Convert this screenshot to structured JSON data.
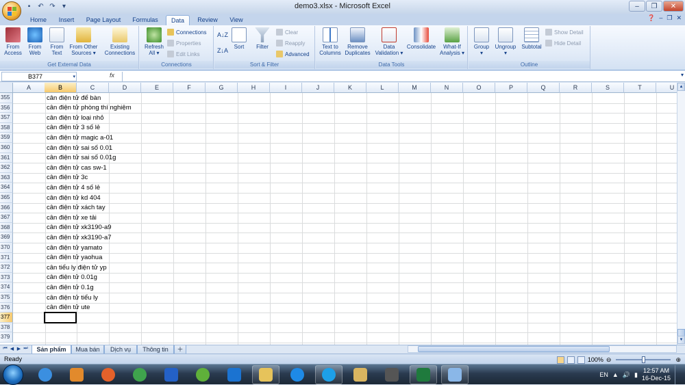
{
  "window": {
    "title": "demo3.xlsx - Microsoft Excel"
  },
  "tabs": [
    "Home",
    "Insert",
    "Page Layout",
    "Formulas",
    "Data",
    "Review",
    "View"
  ],
  "active_tab": "Data",
  "ribbon": {
    "get_external": {
      "label": "Get External Data",
      "from_access": "From\nAccess",
      "from_web": "From\nWeb",
      "from_text": "From\nText",
      "from_other": "From Other\nSources ▾",
      "existing": "Existing\nConnections"
    },
    "connections": {
      "label": "Connections",
      "refresh": "Refresh\nAll ▾",
      "connections": "Connections",
      "properties": "Properties",
      "edit_links": "Edit Links"
    },
    "sort_filter": {
      "label": "Sort & Filter",
      "sort": "Sort",
      "filter": "Filter",
      "clear": "Clear",
      "reapply": "Reapply",
      "advanced": "Advanced"
    },
    "data_tools": {
      "label": "Data Tools",
      "text_to_columns": "Text to\nColumns",
      "remove_duplicates": "Remove\nDuplicates",
      "data_validation": "Data\nValidation ▾",
      "consolidate": "Consolidate",
      "what_if": "What-If\nAnalysis ▾"
    },
    "outline": {
      "label": "Outline",
      "group": "Group\n▾",
      "ungroup": "Ungroup\n▾",
      "subtotal": "Subtotal",
      "show_detail": "Show Detail",
      "hide_detail": "Hide Detail"
    }
  },
  "formula_bar": {
    "name_box": "B377",
    "fx": "fx",
    "value": ""
  },
  "columns": [
    "A",
    "B",
    "C",
    "D",
    "E",
    "F",
    "G",
    "H",
    "I",
    "J",
    "K",
    "L",
    "M",
    "N",
    "O",
    "P",
    "Q",
    "R",
    "S",
    "T",
    "U"
  ],
  "rows": [
    {
      "n": "355",
      "b": "cân điện tử để bàn"
    },
    {
      "n": "356",
      "b": "cân điện tử phòng thí nghiệm"
    },
    {
      "n": "357",
      "b": "cân điện tử loại nhỏ"
    },
    {
      "n": "358",
      "b": "cân điện tử 3 số lẻ"
    },
    {
      "n": "359",
      "b": "cân điện tử magic a-01"
    },
    {
      "n": "360",
      "b": "cân điện tử sai số 0.01"
    },
    {
      "n": "361",
      "b": "cân điện tử sai số 0.01g"
    },
    {
      "n": "362",
      "b": "cân điện tử cas sw-1"
    },
    {
      "n": "363",
      "b": "cân điện tử 3c"
    },
    {
      "n": "364",
      "b": "cân điện tử 4 số lẻ"
    },
    {
      "n": "365",
      "b": "cân điện tử kd 404"
    },
    {
      "n": "366",
      "b": "cân điện tử xách tay"
    },
    {
      "n": "367",
      "b": "cân điện tử xe tải"
    },
    {
      "n": "368",
      "b": "cân điện tử xk3190-a9"
    },
    {
      "n": "369",
      "b": "cân điện tử xk3190-a7"
    },
    {
      "n": "370",
      "b": "cân điện tử yamato"
    },
    {
      "n": "371",
      "b": "cân điện tử yaohua"
    },
    {
      "n": "372",
      "b": "cân tiểu ly điện tử yp"
    },
    {
      "n": "373",
      "b": "cân điện tử 0.01g"
    },
    {
      "n": "374",
      "b": "cân điện tử 0.1g"
    },
    {
      "n": "375",
      "b": "cân điện tử tiểu ly"
    },
    {
      "n": "376",
      "b": "cân điện tử ute"
    },
    {
      "n": "377",
      "b": ""
    },
    {
      "n": "378",
      "b": ""
    },
    {
      "n": "379",
      "b": ""
    }
  ],
  "sheets": [
    "Sản phẩm",
    "Mua bán",
    "Dịch vụ",
    "Thông tin"
  ],
  "active_sheet": "Sản phẩm",
  "status": {
    "ready": "Ready",
    "zoom": "100%"
  },
  "taskbar": {
    "lang": "EN",
    "time": "12:57 AM",
    "date": "16-Dec-15",
    "apps": [
      "ie-icon",
      "media-player-icon",
      "firefox-icon",
      "chrome-icon",
      "remote-icon",
      "coccoc-icon",
      "cuc-icon",
      "folder-icon",
      "zalo-icon",
      "skype-icon",
      "explorer-icon",
      "video-icon",
      "excel-icon",
      "notepad-icon"
    ]
  }
}
